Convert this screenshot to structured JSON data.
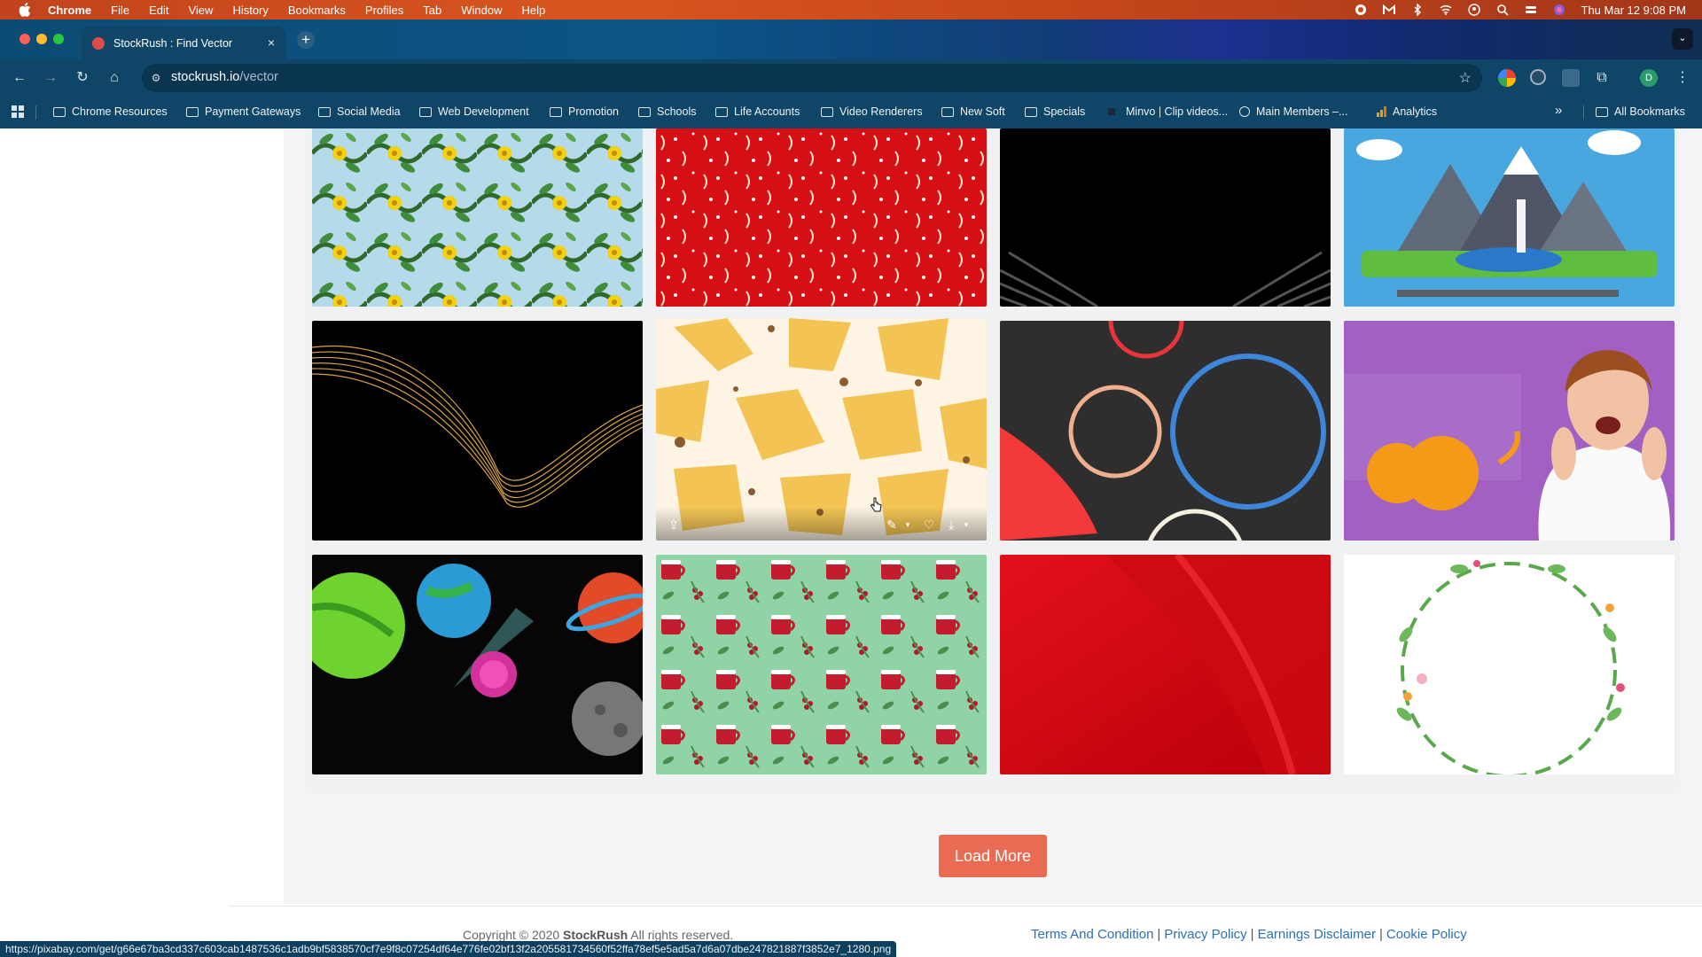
{
  "menubar": {
    "app": "Chrome",
    "items": [
      "File",
      "Edit",
      "View",
      "History",
      "Bookmarks",
      "Profiles",
      "Tab",
      "Window",
      "Help"
    ],
    "clock": "Thu Mar 12  9:08 PM"
  },
  "tab": {
    "title": "StockRush : Find Vector",
    "close": "×"
  },
  "toolbar": {
    "url_host": "stockrush.io",
    "url_path": "/vector",
    "profile_initial": "D"
  },
  "bookmarks": {
    "items": [
      "Chrome Resources",
      "Payment Gateways",
      "Social Media",
      "Web Development",
      "Promotion",
      "Schools",
      "Life Accounts",
      "Video Renderers",
      "New Soft",
      "Specials",
      "Minvo | Clip videos...",
      "Main Members –...",
      "Analytics"
    ],
    "overflow": "»",
    "all": "All Bookmarks"
  },
  "gallery": {
    "cards": [
      {
        "name": "sunflower-leaf-pattern"
      },
      {
        "name": "red-floral-pattern"
      },
      {
        "name": "black-gradient-rays"
      },
      {
        "name": "mountain-lake-lighthouse"
      },
      {
        "name": "gold-wave-lines"
      },
      {
        "name": "yellow-flower-pattern"
      },
      {
        "name": "dark-circles-abstract"
      },
      {
        "name": "surprised-woman-purple"
      },
      {
        "name": "planets-space"
      },
      {
        "name": "christmas-mug-pattern"
      },
      {
        "name": "red-abstract-curve"
      },
      {
        "name": "floral-wreath-frame"
      }
    ]
  },
  "load_more": "Load More",
  "footer": {
    "copyright_prefix": "Copyright © 2020",
    "brand": "StockRush",
    "copyright_suffix": "All rights reserved.",
    "links": [
      "Terms And Condition",
      "Privacy Policy",
      "Earnings Disclaimer",
      "Cookie Policy"
    ]
  },
  "status_url": "https://pixabay.com/get/g66e67ba3cd337c603cab1487536c1adb9bf5838570cf7e9f8c07254df64e776fe02bf13f2a205581734560f52ffa78ef5e5ad5a7d6a07dbe247821887f3852e7_1280.png"
}
